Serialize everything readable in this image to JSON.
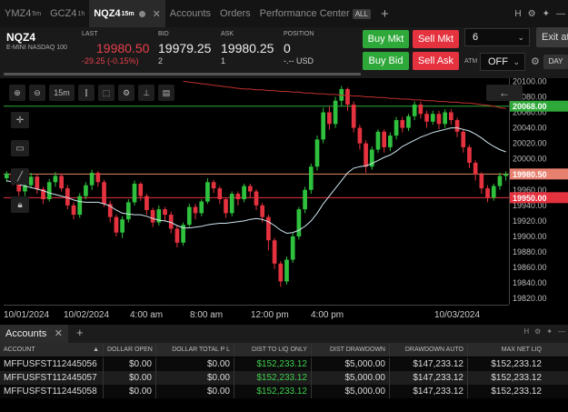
{
  "tabs": [
    {
      "label": "YMZ4",
      "sup": "5m",
      "active": false
    },
    {
      "label": "GCZ4",
      "sup": "1h",
      "active": false
    },
    {
      "label": "NQZ4",
      "sup": "15m",
      "active": true
    }
  ],
  "nav_tabs": [
    "Accounts",
    "Orders",
    "Performance Center"
  ],
  "all_badge": "ALL",
  "quote": {
    "symbol": "NQZ4",
    "description": "E-MINI NASDAQ 100",
    "last_label": "LAST",
    "last": "19980.50",
    "change": "-29.25 (-0.15%)",
    "bid_label": "BID",
    "bid": "19979.25",
    "bid_size": "2",
    "ask_label": "ASK",
    "ask": "19980.25",
    "ask_size": "1",
    "position_label": "POSITION",
    "position": "0",
    "position_pl": "-.-- USD",
    "buy_mkt": "Buy Mkt",
    "sell_mkt": "Sell Mkt",
    "buy_bid": "Buy Bid",
    "sell_ask": "Sell Ask",
    "quantity": "6",
    "exit": "Exit at",
    "atm_label": "ATM",
    "atm_value": "OFF",
    "day": "DAY"
  },
  "chart_toolbar": {
    "interval": "15m"
  },
  "chart_data": {
    "type": "candlestick",
    "y_ticks": [
      "20100.00",
      "20080.00",
      "20060.00",
      "20040.00",
      "20020.00",
      "20000.00",
      "19980.00",
      "19960.00",
      "19940.00",
      "19920.00",
      "19900.00",
      "19880.00",
      "19860.00",
      "19840.00",
      "19820.00"
    ],
    "ylim": [
      19812,
      20104
    ],
    "x_ticks": [
      "10/01/2024",
      "10/02/2024",
      "4:00 am",
      "8:00 am",
      "12:00 pm",
      "4:00 pm",
      "10/03/2024"
    ],
    "price_labels": [
      {
        "value": "20068.00",
        "color": "#2fa83a"
      },
      {
        "value": "19980.50",
        "color": "#e88070"
      },
      {
        "value": "19950.00",
        "color": "#e5323f"
      }
    ],
    "horizontal_lines": [
      {
        "value": 20068,
        "color": "#2fa83a"
      },
      {
        "value": 19980.5,
        "color": "#d9875e"
      },
      {
        "value": 19950,
        "color": "#e5323f"
      }
    ],
    "colors": {
      "up": "#2fc13d",
      "down": "#e5323f",
      "ma_fast": "#cfe7f0",
      "ma_slow": "#c0302e"
    },
    "candles": [
      [
        19975,
        19981,
        19970,
        19984
      ],
      [
        19981,
        19972,
        19966,
        19985
      ],
      [
        19972,
        19958,
        19952,
        19976
      ],
      [
        19958,
        19966,
        19952,
        19971
      ],
      [
        19966,
        19977,
        19962,
        19982
      ],
      [
        19977,
        19961,
        19955,
        19980
      ],
      [
        19961,
        19948,
        19942,
        19964
      ],
      [
        19948,
        19970,
        19945,
        19974
      ],
      [
        19970,
        19978,
        19964,
        19983
      ],
      [
        19978,
        19962,
        19958,
        19981
      ],
      [
        19962,
        19940,
        19935,
        19966
      ],
      [
        19940,
        19928,
        19922,
        19944
      ],
      [
        19928,
        19952,
        19924,
        19956
      ],
      [
        19952,
        19966,
        19948,
        19970
      ],
      [
        19966,
        19982,
        19960,
        19986
      ],
      [
        19982,
        19970,
        19964,
        19984
      ],
      [
        19970,
        19942,
        19938,
        19973
      ],
      [
        19942,
        19925,
        19918,
        19946
      ],
      [
        19925,
        19905,
        19900,
        19928
      ],
      [
        19905,
        19922,
        19898,
        19926
      ],
      [
        19922,
        19944,
        19918,
        19948
      ],
      [
        19944,
        19968,
        19940,
        19972
      ],
      [
        19968,
        19952,
        19946,
        19970
      ],
      [
        19952,
        19934,
        19928,
        19955
      ],
      [
        19934,
        19918,
        19912,
        19937
      ],
      [
        19918,
        19935,
        19914,
        19940
      ],
      [
        19935,
        19928,
        19920,
        19938
      ],
      [
        19928,
        19910,
        19904,
        19932
      ],
      [
        19910,
        19892,
        19886,
        19914
      ],
      [
        19892,
        19915,
        19888,
        19918
      ],
      [
        19915,
        19938,
        19912,
        19942
      ],
      [
        19938,
        19930,
        19922,
        19942
      ],
      [
        19930,
        19945,
        19926,
        19948
      ],
      [
        19945,
        19970,
        19942,
        19975
      ],
      [
        19970,
        19962,
        19956,
        19973
      ],
      [
        19962,
        19948,
        19942,
        19965
      ],
      [
        19948,
        19930,
        19924,
        19950
      ],
      [
        19930,
        19955,
        19926,
        19958
      ],
      [
        19955,
        19948,
        19940,
        19958
      ],
      [
        19948,
        19965,
        19944,
        19968
      ],
      [
        19965,
        19958,
        19950,
        19968
      ],
      [
        19958,
        19940,
        19934,
        19961
      ],
      [
        19940,
        19925,
        19918,
        19943
      ],
      [
        19925,
        19895,
        19882,
        19928
      ],
      [
        19895,
        19865,
        19858,
        19898
      ],
      [
        19865,
        19842,
        19835,
        19868
      ],
      [
        19842,
        19870,
        19838,
        19874
      ],
      [
        19870,
        19900,
        19866,
        19904
      ],
      [
        19900,
        19935,
        19896,
        19938
      ],
      [
        19935,
        19960,
        19930,
        19964
      ],
      [
        19960,
        19990,
        19955,
        19994
      ],
      [
        19990,
        20025,
        19985,
        20030
      ],
      [
        20025,
        20060,
        20020,
        20066
      ],
      [
        20060,
        20045,
        20038,
        20068
      ],
      [
        20045,
        20075,
        20040,
        20080
      ],
      [
        20075,
        20090,
        20068,
        20094
      ],
      [
        20090,
        20070,
        20062,
        20092
      ],
      [
        20070,
        20040,
        20034,
        20074
      ],
      [
        20040,
        20020,
        20012,
        20044
      ],
      [
        20020,
        19990,
        19982,
        20024
      ],
      [
        19990,
        20012,
        19986,
        20016
      ],
      [
        20012,
        20035,
        20008,
        20038
      ],
      [
        20035,
        20015,
        20008,
        20038
      ],
      [
        20015,
        20030,
        20010,
        20034
      ],
      [
        20030,
        20050,
        20025,
        20054
      ],
      [
        20050,
        20040,
        20034,
        20054
      ],
      [
        20040,
        20055,
        20036,
        20058
      ],
      [
        20055,
        20070,
        20050,
        20074
      ],
      [
        20070,
        20058,
        20052,
        20074
      ],
      [
        20058,
        20048,
        20040,
        20062
      ],
      [
        20048,
        20058,
        20044,
        20062
      ],
      [
        20058,
        20045,
        20038,
        20062
      ],
      [
        20045,
        20060,
        20040,
        20064
      ],
      [
        20060,
        20050,
        20044,
        20064
      ],
      [
        20050,
        20035,
        20028,
        20053
      ],
      [
        20035,
        20015,
        20008,
        20038
      ],
      [
        20015,
        19995,
        19988,
        20018
      ],
      [
        19995,
        19980,
        19972,
        19998
      ],
      [
        19980,
        19962,
        19955,
        19983
      ],
      [
        19962,
        19950,
        19944,
        19966
      ],
      [
        19950,
        19965,
        19946,
        19968
      ],
      [
        19965,
        19978,
        19960,
        19982
      ],
      [
        19978,
        19980.5,
        19972,
        19984
      ]
    ],
    "ma_fast": [
      19972,
      19970,
      19967,
      19965,
      19963,
      19961,
      19959,
      19956,
      19954,
      19952,
      19950,
      19947,
      19945,
      19944,
      19944,
      19944,
      19942,
      19939,
      19934,
      19930,
      19929,
      19928,
      19928,
      19926,
      19923,
      19921,
      19920,
      19918,
      19914,
      19911,
      19911,
      19912,
      19913,
      19915,
      19916,
      19917,
      19917,
      19918,
      19919,
      19920,
      19922,
      19923,
      19922,
      19919,
      19914,
      19908,
      19904,
      19905,
      19908,
      19913,
      19920,
      19930,
      19942,
      19952,
      19962,
      19972,
      19982,
      19988,
      19990,
      19991,
      19994,
      19998,
      20002,
      20005,
      20010,
      20016,
      20020,
      20024,
      20028,
      20031,
      20034,
      20036,
      20038,
      20040,
      20040,
      20038,
      20036,
      20032,
      20027,
      20021,
      20016,
      20012,
      20009
    ],
    "ma_slow_start_index": 29,
    "ma_slow": [
      20100,
      20099,
      20098,
      20097,
      20096,
      20095,
      20094,
      20093,
      20092,
      20091,
      20090,
      20090,
      20089,
      20089,
      20088,
      20088,
      20087,
      20087,
      20086,
      20086,
      20085,
      20085,
      20084,
      20084,
      20083,
      20083,
      20082,
      20082,
      20081,
      20081,
      20080,
      20080,
      20079,
      20079,
      20078,
      20078,
      20077,
      20077,
      20076,
      20076,
      20075,
      20075,
      20074,
      20074,
      20073,
      20073,
      20072,
      20072,
      20071,
      20070,
      20069,
      20068,
      20066,
      20065
    ]
  },
  "accounts_panel": {
    "tab_label": "Accounts",
    "columns": [
      "ACCOUNT",
      "DOLLAR OPEN",
      "DOLLAR TOTAL P L",
      "DIST TO LIQ ONLY",
      "DIST DRAWDOWN",
      "DRAWDOWN AUTO",
      "MAX NET LIQ"
    ],
    "rows": [
      [
        "MFFUSFST112445056",
        "$0.00",
        "$0.00",
        "$152,233.12",
        "$5,000.00",
        "$147,233.12",
        "$152,233.12"
      ],
      [
        "MFFUSFST112445057",
        "$0.00",
        "$0.00",
        "$152,233.12",
        "$5,000.00",
        "$147,233.12",
        "$152,233.12"
      ],
      [
        "MFFUSFST112445058",
        "$0.00",
        "$0.00",
        "$152,233.12",
        "$5,000.00",
        "$147,233.12",
        "$152,233.12"
      ]
    ]
  }
}
